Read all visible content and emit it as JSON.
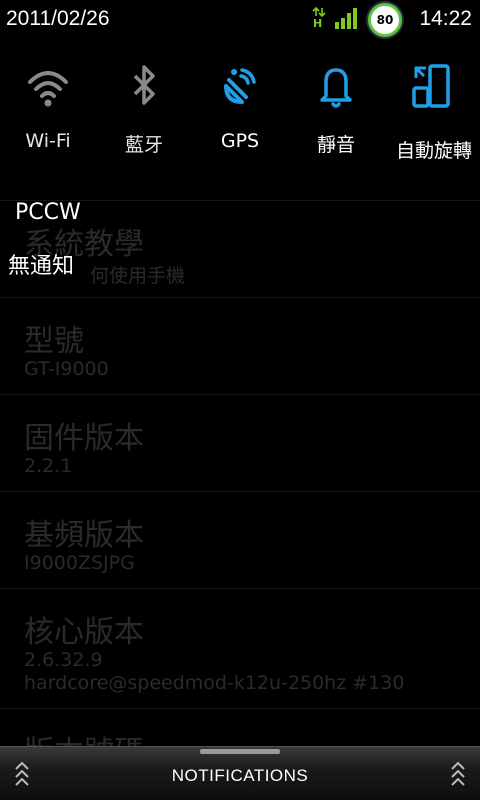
{
  "status_bar": {
    "date": "2011/02/26",
    "time": "14:22",
    "data_type": "H",
    "battery_level": "80",
    "signal_bars": 4,
    "signal_icon": "signal-bars-icon",
    "battery_icon": "battery-circle-icon"
  },
  "toggles": [
    {
      "label": "Wi-Fi",
      "icon": "wifi-icon",
      "active": false
    },
    {
      "label": "藍牙",
      "icon": "bluetooth-icon",
      "active": false
    },
    {
      "label": "GPS",
      "icon": "gps-icon",
      "active": true
    },
    {
      "label": "靜音",
      "icon": "bell-icon",
      "active": true
    },
    {
      "label": "自動旋轉",
      "icon": "rotate-icon",
      "active": true
    }
  ],
  "colors": {
    "active_blue": "#1f9fe8",
    "inactive_gray": "#8a8a8a",
    "battery_green": "#5ec43a"
  },
  "notification": {
    "carrier": "PCCW",
    "empty_text": "無通知"
  },
  "settings_list": [
    {
      "title": "系統教學",
      "subtitle": "何使用手機"
    },
    {
      "title": "型號",
      "subtitle": "GT-I9000"
    },
    {
      "title": "固件版本",
      "subtitle": "2.2.1"
    },
    {
      "title": "基頻版本",
      "subtitle": "I9000ZSJPG"
    },
    {
      "title": "核心版本",
      "subtitle": "2.6.32.9",
      "subtitle2": "hardcore@speedmod-k12u-250hz #130"
    },
    {
      "title": "版本號碼",
      "subtitle": ""
    }
  ],
  "bottom_bar": {
    "label": "NOTIFICATIONS"
  }
}
